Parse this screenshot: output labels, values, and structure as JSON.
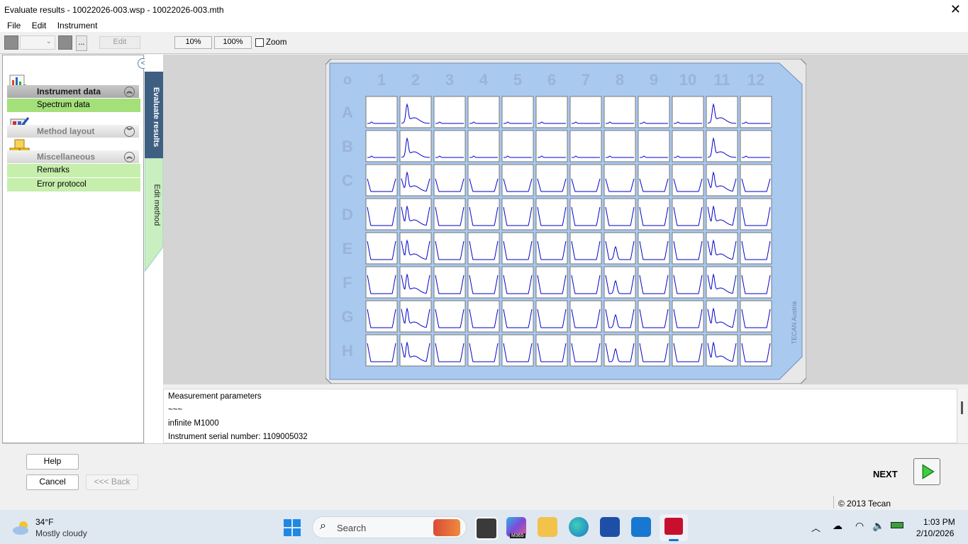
{
  "window": {
    "title": "Evaluate results - 10022026-003.wsp - 10022026-003.mth",
    "close_glyph": "✕"
  },
  "menu": [
    "File",
    "Edit",
    "Instrument"
  ],
  "toolbar": {
    "edit_label": "Edit",
    "zoom10": "10%",
    "zoom100": "100%",
    "zoom_label": "Zoom",
    "ellipsis": "...",
    "zoom_checked": false
  },
  "sidebar": {
    "groups": [
      {
        "label": "Instrument data",
        "icon": "chart-icon",
        "expanded": true,
        "items": [
          "Spectrum data"
        ]
      },
      {
        "label": "Method layout",
        "icon": "pencil-layout-icon",
        "expanded": false,
        "items": []
      },
      {
        "label": "Miscellaneous",
        "icon": "boxes-icon",
        "expanded": true,
        "items": [
          "Remarks",
          "Error protocol"
        ]
      }
    ]
  },
  "vertical_tabs": {
    "active": "Evaluate results",
    "inactive": "Edit method"
  },
  "plate": {
    "corner": "o",
    "columns": [
      "1",
      "2",
      "3",
      "4",
      "5",
      "6",
      "7",
      "8",
      "9",
      "10",
      "11",
      "12"
    ],
    "rows": [
      "A",
      "B",
      "C",
      "D",
      "E",
      "F",
      "G",
      "H"
    ],
    "brand": "TECAN Austria",
    "colors": {
      "frame": "#a9c9ef",
      "label": "#9bb3d6",
      "trace": "#0000cc"
    }
  },
  "parameters": {
    "lines": [
      "Measurement parameters",
      "~~~",
      "infinite M1000",
      "Instrument serial number: 1109005032"
    ]
  },
  "footer": {
    "help": "Help",
    "cancel": "Cancel",
    "back": "<<< Back",
    "next": "NEXT",
    "copyright": "© 2013 Tecan"
  },
  "taskbar": {
    "weather_temp": "34°F",
    "weather_desc": "Mostly cloudy",
    "search_placeholder": "Search",
    "time": "1:03 PM",
    "date": "2/10/2026",
    "m365_label": "M365"
  }
}
